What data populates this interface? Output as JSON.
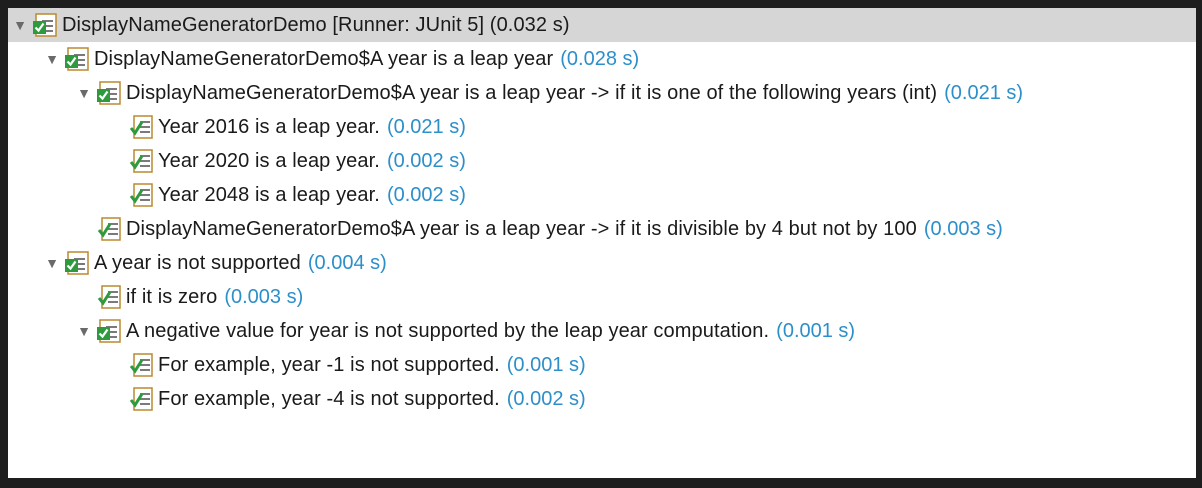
{
  "tree": {
    "items": [
      {
        "level": 0,
        "expanded": true,
        "icon": "test-suite-passed-icon",
        "label": "DisplayNameGeneratorDemo [Runner: JUnit 5] (0.032 s)",
        "time": ""
      },
      {
        "level": 1,
        "expanded": true,
        "icon": "test-suite-passed-icon",
        "label": "DisplayNameGeneratorDemo$A year is a leap year",
        "time": "(0.028 s)"
      },
      {
        "level": 2,
        "expanded": true,
        "icon": "test-suite-passed-icon",
        "label": "DisplayNameGeneratorDemo$A year is a leap year -> if it is one of the following years (int)",
        "time": "(0.021 s)"
      },
      {
        "level": 3,
        "expanded": null,
        "icon": "test-passed-icon",
        "label": "Year 2016 is a leap year.",
        "time": "(0.021 s)"
      },
      {
        "level": 3,
        "expanded": null,
        "icon": "test-passed-icon",
        "label": "Year 2020 is a leap year.",
        "time": "(0.002 s)"
      },
      {
        "level": 3,
        "expanded": null,
        "icon": "test-passed-icon",
        "label": "Year 2048 is a leap year.",
        "time": "(0.002 s)"
      },
      {
        "level": 2,
        "expanded": null,
        "icon": "test-passed-icon",
        "label": "DisplayNameGeneratorDemo$A year is a leap year -> if it is divisible by 4 but not by 100",
        "time": "(0.003 s)"
      },
      {
        "level": 1,
        "expanded": true,
        "icon": "test-suite-passed-icon",
        "label": "A year is not supported",
        "time": "(0.004 s)"
      },
      {
        "level": 2,
        "expanded": null,
        "icon": "test-passed-icon",
        "label": "if it is zero",
        "time": "(0.003 s)"
      },
      {
        "level": 2,
        "expanded": true,
        "icon": "test-suite-passed-icon",
        "label": "A negative value for year is not supported by the leap year computation.",
        "time": "(0.001 s)"
      },
      {
        "level": 3,
        "expanded": null,
        "icon": "test-passed-icon",
        "label": "For example, year -1 is not supported.",
        "time": "(0.001 s)"
      },
      {
        "level": 3,
        "expanded": null,
        "icon": "test-passed-icon",
        "label": "For example, year -4 is not supported.",
        "time": "(0.002 s)"
      }
    ]
  },
  "colors": {
    "time": "#2d8fc9",
    "check": "#2e9a3e",
    "icon_border": "#b98a2e",
    "selected_row": "#d6d6d6"
  }
}
